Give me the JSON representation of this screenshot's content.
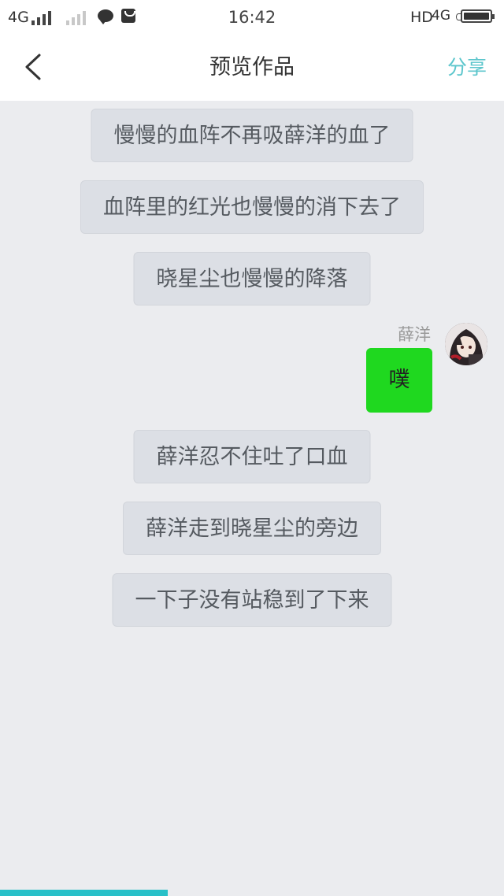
{
  "status_bar": {
    "network_left": "4G",
    "time": "16:42",
    "hd_label": "HD",
    "network_right": "4G"
  },
  "header": {
    "title": "预览作品",
    "share_label": "分享",
    "back_icon": "chevron-left-icon"
  },
  "messages": [
    {
      "text": "慢慢的血阵不再吸薛洋的血了"
    },
    {
      "text": "血阵里的红光也慢慢的消下去了"
    },
    {
      "text": "晓星尘也慢慢的降落"
    },
    {
      "text": "薛洋忍不住吐了口血"
    },
    {
      "text": "薛洋走到晓星尘的旁边"
    },
    {
      "text": "一下子没有站稳到了下来"
    }
  ],
  "reply": {
    "sender": "薛洋",
    "text": "噗"
  },
  "progress": {
    "fraction": 0.333
  },
  "colors": {
    "accent": "#28c0c8",
    "share": "#5cc6cc",
    "reply_bubble": "#1fd81f",
    "narration_bubble": "#dcdfe5",
    "background": "#ebecef"
  }
}
